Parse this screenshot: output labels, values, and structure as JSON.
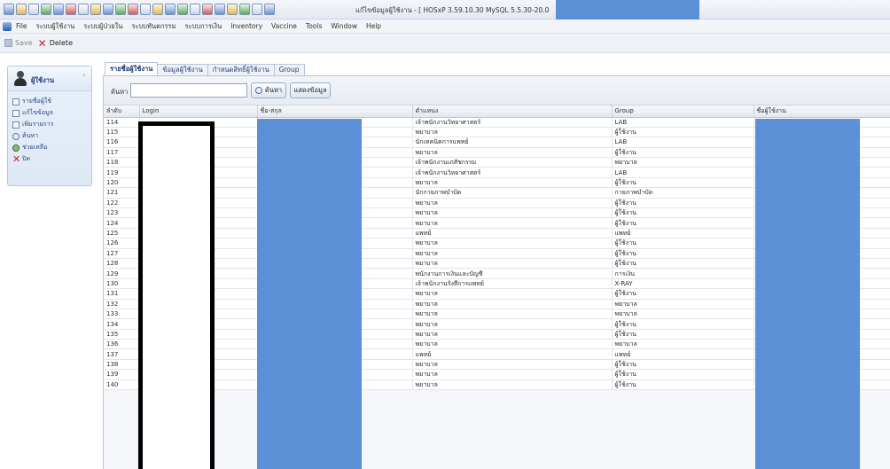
{
  "window": {
    "title": "แก้ไขข้อมูลผู้ใช้งาน - [ HOSxP 3.59.10.30 MySQL 5.5.30-20.0"
  },
  "menubar": {
    "items": [
      "File",
      "ระบบผู้ใช้งาน",
      "ระบบผู้ป่วยใน",
      "ระบบทันตกรรม",
      "ระบบการเงิน",
      "Inventory",
      "Vaccine",
      "Tools",
      "Window",
      "Help"
    ]
  },
  "toolbar": {
    "save_label": "Save",
    "delete_label": "Delete"
  },
  "sidebar": {
    "title": "ผู้ใช้งาน",
    "items": [
      {
        "label": "รายชื่อผู้ใช้",
        "icon": "list-icon"
      },
      {
        "label": "แก้ไขข้อมูล",
        "icon": "edit-icon"
      },
      {
        "label": "เพิ่มรายการ",
        "icon": "add-icon"
      },
      {
        "label": "ค้นหา",
        "icon": "search-icon"
      },
      {
        "label": "ช่วยเหลือ",
        "icon": "user-icon"
      },
      {
        "label": "ปิด",
        "icon": "close-icon"
      }
    ]
  },
  "tabs": [
    "รายชื่อผู้ใช้งาน",
    "ข้อมูลผู้ใช้งาน",
    "กำหนดสิทธิ์ผู้ใช้งาน",
    "Group"
  ],
  "search": {
    "label": "ค้นหา",
    "value": "",
    "search_button": "ค้นหา",
    "refresh_button": "แสดงข้อมูล"
  },
  "table": {
    "columns": [
      "ลำดับ",
      "Login",
      "ชื่อ-สกุล",
      "ตำแหน่ง",
      "Group",
      "ชื่อผู้ใช้งาน"
    ],
    "rows": [
      {
        "no": "114",
        "position": "เจ้าพนักงานวิทยาศาสตร์",
        "group": "LAB"
      },
      {
        "no": "115",
        "position": "พยาบาล",
        "group": "ผู้ใช้งาน"
      },
      {
        "no": "116",
        "position": "นักเทคนิคการแพทย์",
        "group": "LAB"
      },
      {
        "no": "117",
        "position": "พยาบาล",
        "group": "ผู้ใช้งาน"
      },
      {
        "no": "118",
        "position": "เจ้าพนักงานเภสัชกรรม",
        "group": "พยาบาล"
      },
      {
        "no": "119",
        "position": "เจ้าพนักงานวิทยาศาสตร์",
        "group": "LAB"
      },
      {
        "no": "120",
        "position": "พยาบาล",
        "group": "ผู้ใช้งาน"
      },
      {
        "no": "121",
        "position": "นักกายภาพบำบัด",
        "group": "กายภาพบำบัด"
      },
      {
        "no": "122",
        "position": "พยาบาล",
        "group": "ผู้ใช้งาน"
      },
      {
        "no": "123",
        "position": "พยาบาล",
        "group": "ผู้ใช้งาน"
      },
      {
        "no": "124",
        "position": "พยาบาล",
        "group": "ผู้ใช้งาน"
      },
      {
        "no": "125",
        "position": "แพทย์",
        "group": "แพทย์"
      },
      {
        "no": "126",
        "position": "พยาบาล",
        "group": "ผู้ใช้งาน"
      },
      {
        "no": "127",
        "position": "พยาบาล",
        "group": "ผู้ใช้งาน"
      },
      {
        "no": "128",
        "position": "พยาบาล",
        "group": "ผู้ใช้งาน"
      },
      {
        "no": "129",
        "position": "พนักงานการเงินและบัญชี",
        "group": "การเงิน"
      },
      {
        "no": "130",
        "position": "เจ้าพนักงานรังสีการแพทย์",
        "group": "X-RAY"
      },
      {
        "no": "131",
        "position": "พยาบาล",
        "group": "ผู้ใช้งาน"
      },
      {
        "no": "132",
        "position": "พยาบาล",
        "group": "พยาบาล"
      },
      {
        "no": "133",
        "position": "พยาบาล",
        "group": "พยาบาล"
      },
      {
        "no": "134",
        "position": "พยาบาล",
        "group": "ผู้ใช้งาน"
      },
      {
        "no": "135",
        "position": "พยาบาล",
        "group": "ผู้ใช้งาน"
      },
      {
        "no": "136",
        "position": "พยาบาล",
        "group": "พยาบาล"
      },
      {
        "no": "137",
        "position": "แพทย์",
        "group": "แพทย์"
      },
      {
        "no": "138",
        "position": "พยาบาล",
        "group": "ผู้ใช้งาน"
      },
      {
        "no": "139",
        "position": "พยาบาล",
        "group": "ผู้ใช้งาน"
      },
      {
        "no": "140",
        "position": "พยาบาล",
        "group": "ผู้ใช้งาน"
      }
    ]
  },
  "colors": {
    "redaction_blue": "#5b8fd6",
    "accent": "#1f3f7a",
    "delete_red": "#d42424"
  }
}
